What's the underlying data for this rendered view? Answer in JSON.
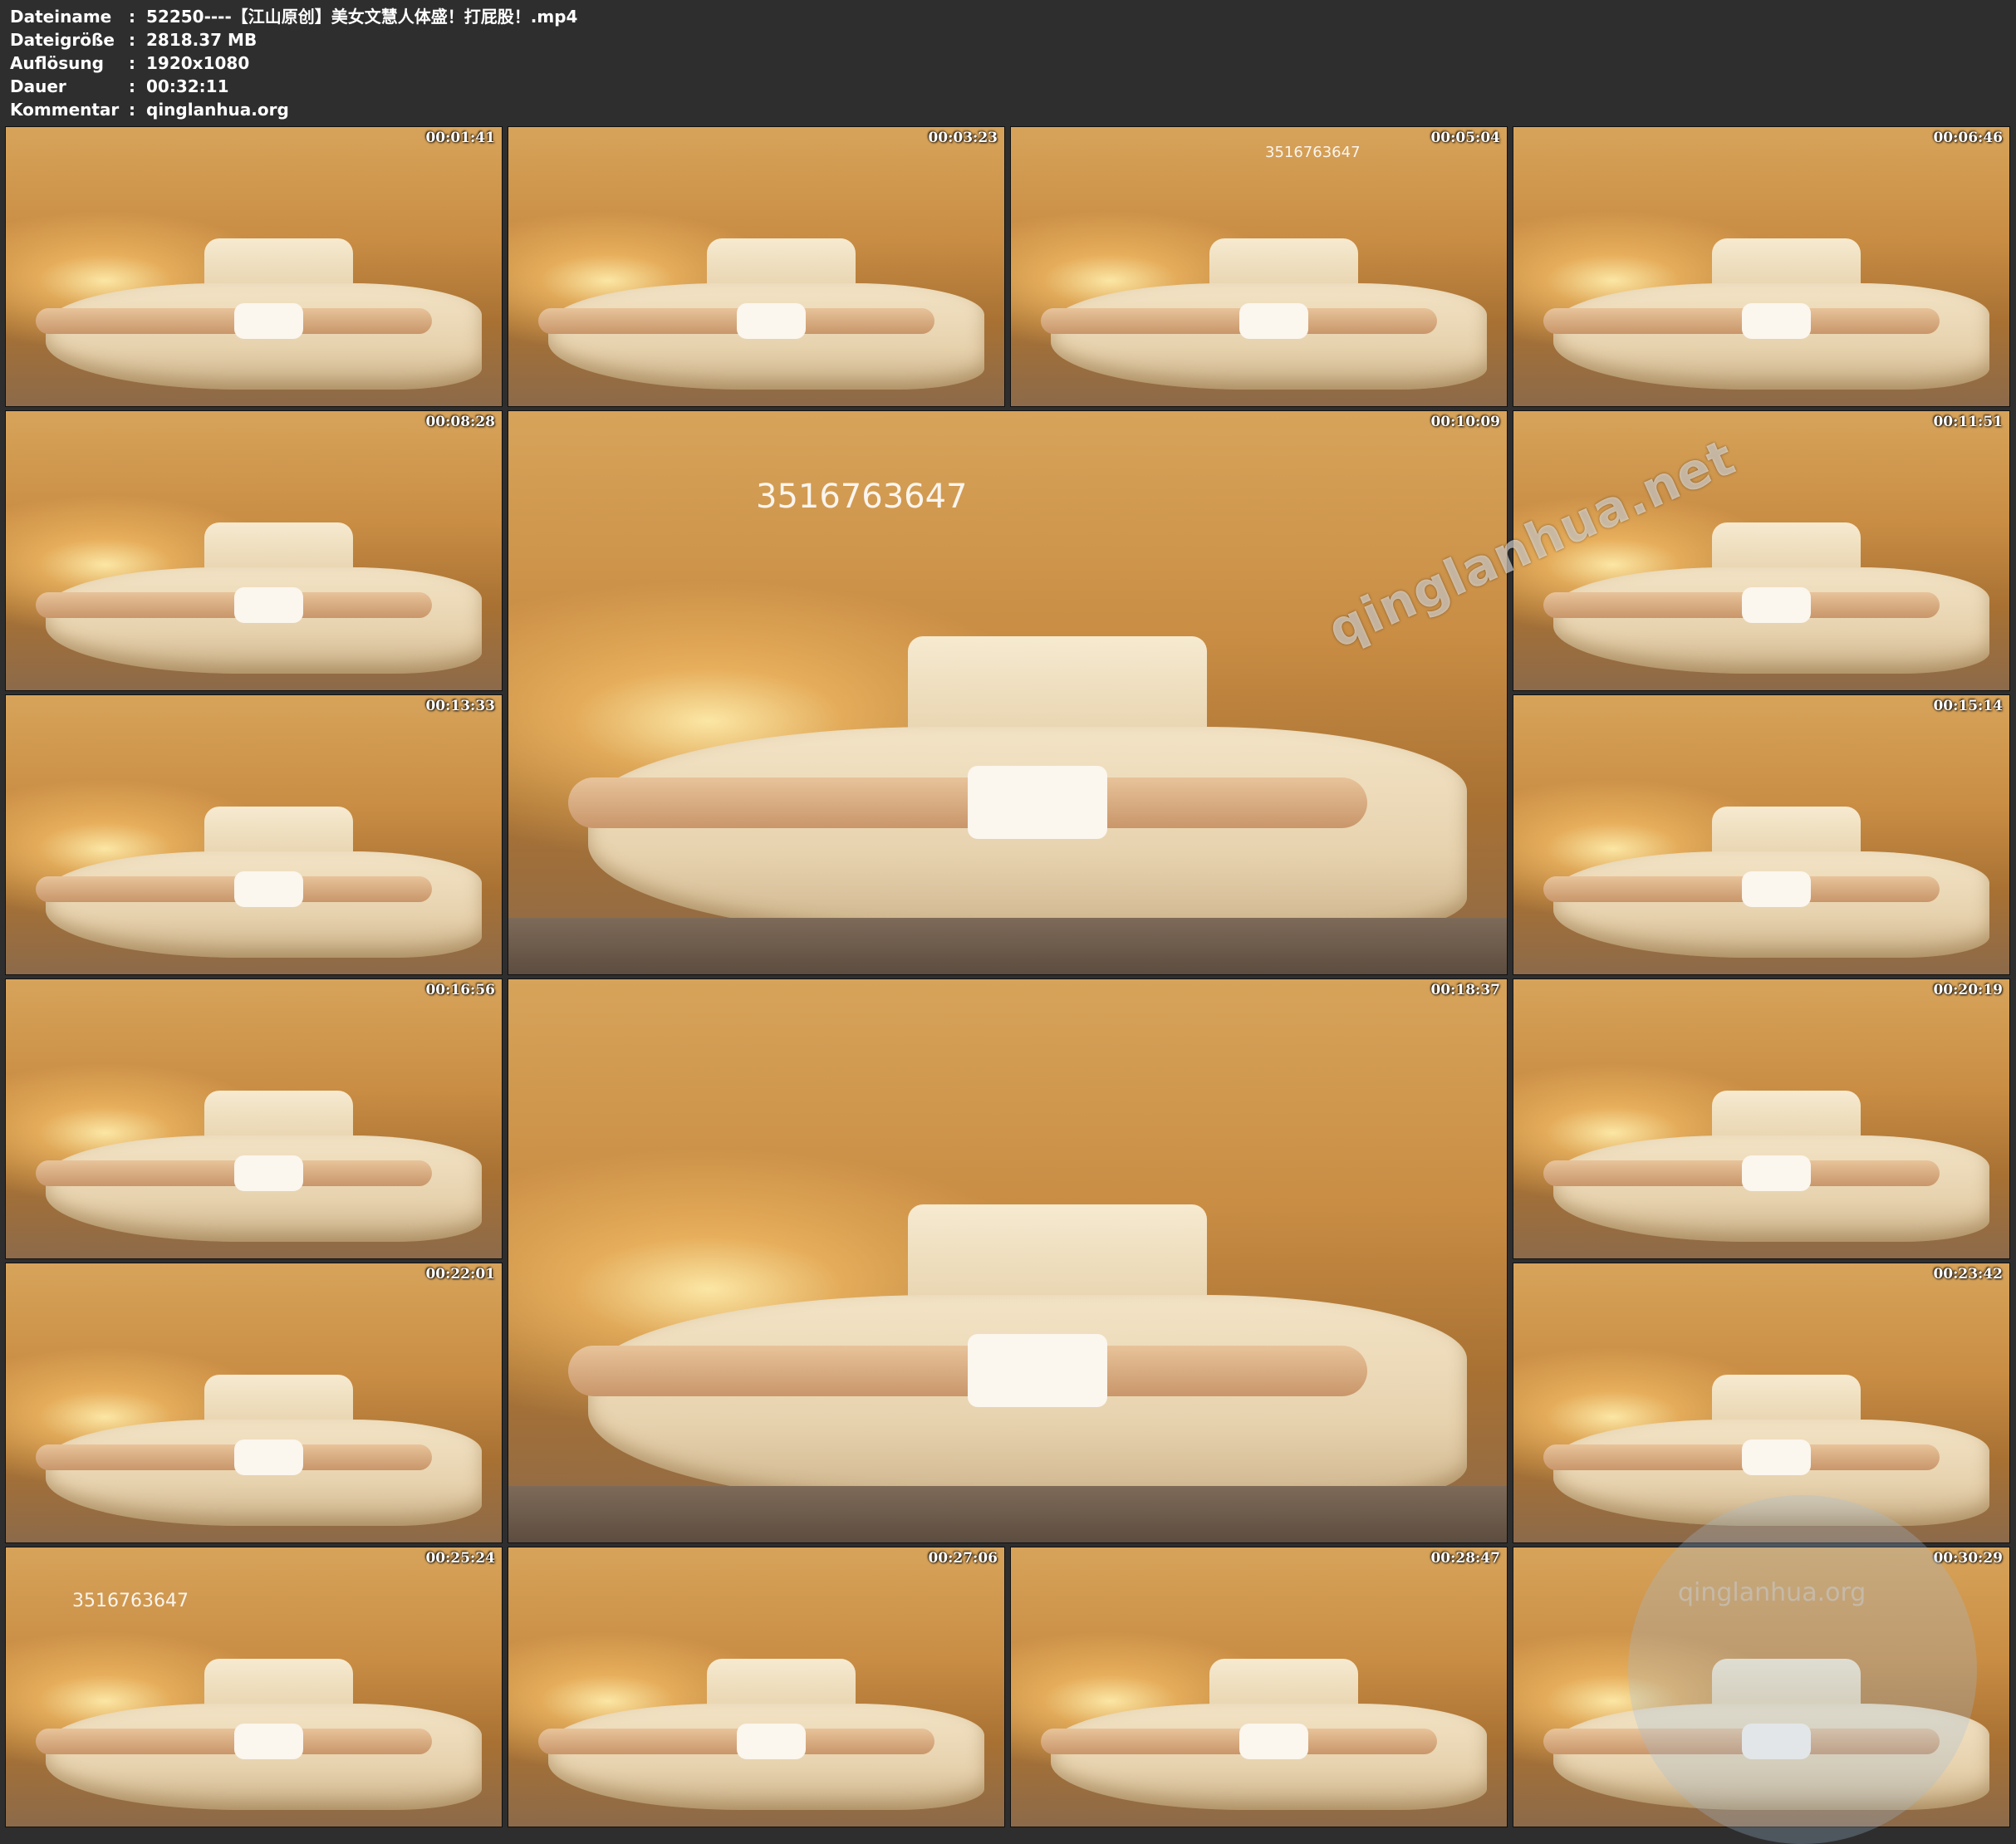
{
  "info": {
    "rows": [
      {
        "key": "Dateiname",
        "sep": ":",
        "value": "52250----【江山原创】美女文慧人体盛！打屁股！.mp4"
      },
      {
        "key": "Dateigröße",
        "sep": ":",
        "value": "2818.37 MB"
      },
      {
        "key": "Auflösung",
        "sep": ":",
        "value": "1920x1080"
      },
      {
        "key": "Dauer",
        "sep": ":",
        "value": "00:32:11"
      },
      {
        "key": "Kommentar",
        "sep": ":",
        "value": "qinglanhua.org"
      }
    ]
  },
  "thumbnails": [
    {
      "time": "00:01:41",
      "mark": ""
    },
    {
      "time": "00:03:23",
      "mark": ""
    },
    {
      "time": "00:05:04",
      "mark": "3516763647"
    },
    {
      "time": "00:06:46",
      "mark": ""
    },
    {
      "time": "00:08:28",
      "mark": ""
    },
    {
      "time": "00:10:09",
      "mark": "3516763647"
    },
    {
      "time": "00:11:51",
      "mark": ""
    },
    {
      "time": "00:13:33",
      "mark": ""
    },
    {
      "time": "00:15:14",
      "mark": ""
    },
    {
      "time": "00:16:56",
      "mark": ""
    },
    {
      "time": "00:18:37",
      "mark": ""
    },
    {
      "time": "00:20:19",
      "mark": ""
    },
    {
      "time": "00:22:01",
      "mark": ""
    },
    {
      "time": "00:23:42",
      "mark": ""
    },
    {
      "time": "00:25:24",
      "mark": "3516763647"
    },
    {
      "time": "00:27:06",
      "mark": ""
    },
    {
      "time": "00:28:47",
      "mark": ""
    },
    {
      "time": "00:30:29",
      "mark": ""
    }
  ],
  "watermarks": {
    "diagonal": "qinglanhua.net",
    "bottom": "qinglanhua.org"
  }
}
